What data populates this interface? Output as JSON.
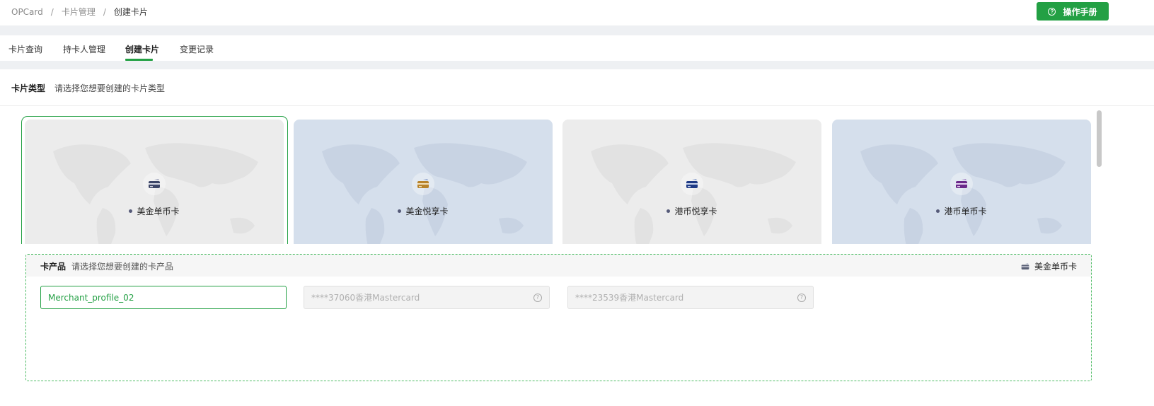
{
  "breadcrumb": {
    "root": "OPCard",
    "sep": "/",
    "level2": "卡片管理",
    "current": "创建卡片"
  },
  "header": {
    "manual_label": "操作手册",
    "manual_icon": "question-circle-icon"
  },
  "tabs": [
    {
      "label": "卡片查询"
    },
    {
      "label": "持卡人管理"
    },
    {
      "label": "创建卡片",
      "active": true
    },
    {
      "label": "变更记录"
    }
  ],
  "card_type": {
    "label": "卡片类型",
    "hint": "请选择您想要创建的卡片类型"
  },
  "cards": [
    {
      "name": "美金单币卡",
      "icon": "card-icon",
      "icon_color": "#3d4668",
      "selected": true
    },
    {
      "name": "美金悦享卡",
      "icon": "card-icon",
      "icon_color": "#b8832b"
    },
    {
      "name": "港币悦享卡",
      "icon": "card-icon",
      "icon_color": "#1f3b86"
    },
    {
      "name": "港币单币卡",
      "icon": "card-icon",
      "icon_color": "#6b2a8a"
    }
  ],
  "product": {
    "label": "卡产品",
    "hint": "请选择您想要创建的卡产品",
    "selected_card": "美金单币卡",
    "options": [
      {
        "label": "Merchant_profile_02",
        "state": "active"
      },
      {
        "label": "****37060香港Mastercard",
        "state": "disabled"
      },
      {
        "label": "****23539香港Mastercard",
        "state": "disabled"
      }
    ]
  },
  "colors": {
    "accent": "#23a044",
    "page_bg": "#eef0f3",
    "card_gray": "#ececec",
    "card_blue": "#d5dfec"
  }
}
